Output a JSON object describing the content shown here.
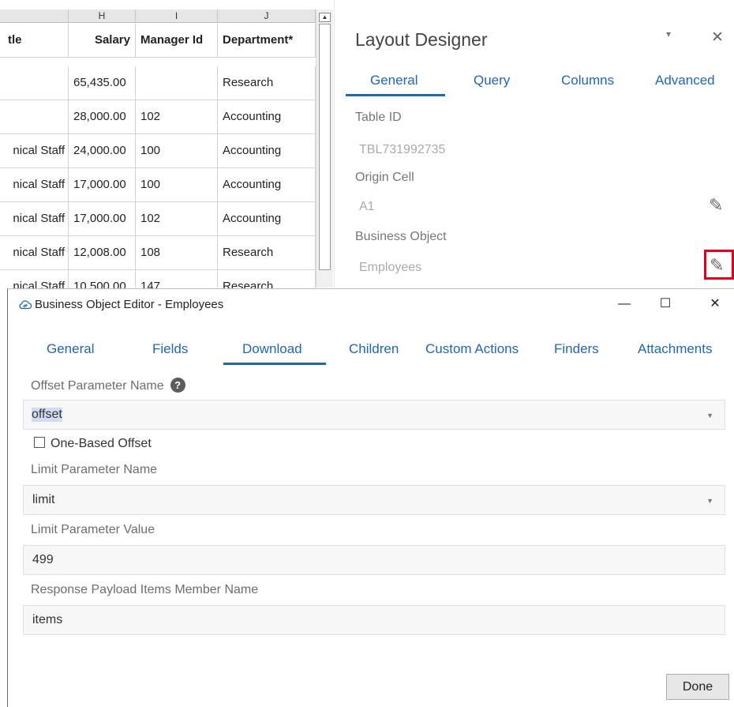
{
  "sheet": {
    "col_headers": [
      "H",
      "I",
      "J"
    ],
    "headers": {
      "title": "tle",
      "salary": "Salary",
      "manager": "Manager Id",
      "department": "Department*"
    },
    "rows": [
      {
        "title": "",
        "salary": "65,435.00",
        "manager": "",
        "department": "Research"
      },
      {
        "title": "",
        "salary": "28,000.00",
        "manager": "102",
        "department": "Accounting"
      },
      {
        "title": "nical Staff",
        "salary": "24,000.00",
        "manager": "100",
        "department": "Accounting"
      },
      {
        "title": "nical Staff",
        "salary": "17,000.00",
        "manager": "100",
        "department": "Accounting"
      },
      {
        "title": "nical Staff",
        "salary": "17,000.00",
        "manager": "102",
        "department": "Accounting"
      },
      {
        "title": "nical Staff",
        "salary": "12,008.00",
        "manager": "108",
        "department": "Research"
      },
      {
        "title": "nical Staff",
        "salary": "10,500.00",
        "manager": "147",
        "department": "Research"
      }
    ]
  },
  "layout_designer": {
    "title": "Layout Designer",
    "dropdown_glyph": "▾",
    "close_glyph": "✕",
    "tabs": [
      "General",
      "Query",
      "Columns",
      "Advanced"
    ],
    "active_tab": "General",
    "table_id_label": "Table ID",
    "table_id_value": "TBL731992735",
    "origin_cell_label": "Origin Cell",
    "origin_cell_value": "A1",
    "business_object_label": "Business Object",
    "business_object_value": "Employees",
    "pencil_glyph": "✎",
    "highlight_color": "#e3001b"
  },
  "dialog": {
    "title": "Business Object Editor - Employees",
    "minimize_glyph": "—",
    "maximize_glyph": "☐",
    "close_glyph": "✕",
    "tabs": [
      "General",
      "Fields",
      "Download",
      "Children",
      "Custom Actions",
      "Finders",
      "Attachments"
    ],
    "active_tab": "Download",
    "offset_label": "Offset Parameter Name",
    "help_glyph": "?",
    "offset_value": "offset",
    "one_based_label": "One-Based Offset",
    "one_based_checked": false,
    "limit_name_label": "Limit Parameter Name",
    "limit_name_value": "limit",
    "limit_value_label": "Limit Parameter Value",
    "limit_value": "499",
    "items_member_label": "Response Payload Items Member Name",
    "items_member_value": "items",
    "caret_glyph": "▼",
    "done_label": "Done"
  },
  "colors": {
    "accent": "#1f66b8"
  },
  "icons": {
    "app_icon": "cloud-sync-icon",
    "edit": "pencil-icon",
    "help": "question-circle-icon"
  }
}
